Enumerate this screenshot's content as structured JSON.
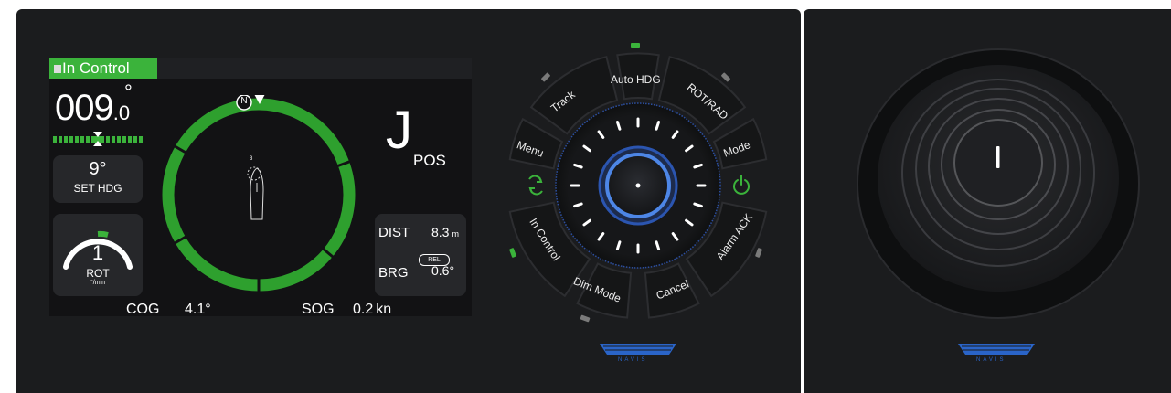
{
  "display": {
    "status": "In Control",
    "heading": {
      "whole": "009",
      "decimal": ".0",
      "degree_symbol": "°"
    },
    "set_hdg": {
      "value": "9°",
      "label": "SET HDG"
    },
    "rot": {
      "value": "1",
      "label": "ROT",
      "unit": "°/min"
    },
    "compass": {
      "north_label": "N",
      "mode_letter": "J",
      "mode_label": "POS",
      "vessel_marker": "3"
    },
    "dist": {
      "label": "DIST",
      "value": "8.3",
      "unit": "m"
    },
    "brg": {
      "label": "BRG",
      "badge": "REL",
      "value": "0.6°"
    },
    "cog": {
      "label": "COG",
      "value": "4.1°"
    },
    "sog": {
      "label": "SOG",
      "value": "0.2",
      "unit": "kn"
    }
  },
  "controls": {
    "buttons": {
      "auto_hdg": "Auto HDG",
      "track": "Track",
      "rot_rad": "ROT/RAD",
      "menu": "Menu",
      "mode": "Mode",
      "in_control": "In Control",
      "alarm_ack": "Alarm ACK",
      "dim_mode": "Dim Mode",
      "cancel": "Cancel"
    },
    "brand": "NAVIS"
  },
  "joystick": {
    "brand": "NAVIS"
  },
  "colors": {
    "accent_green": "#3bb33b",
    "panel": "#1b1c1e",
    "knob_blue": "#3a6fd0",
    "brand_blue": "#2a64c8"
  },
  "icons": [
    "refresh-icon",
    "power-icon",
    "compass-north-marker-icon",
    "vessel-icon"
  ]
}
